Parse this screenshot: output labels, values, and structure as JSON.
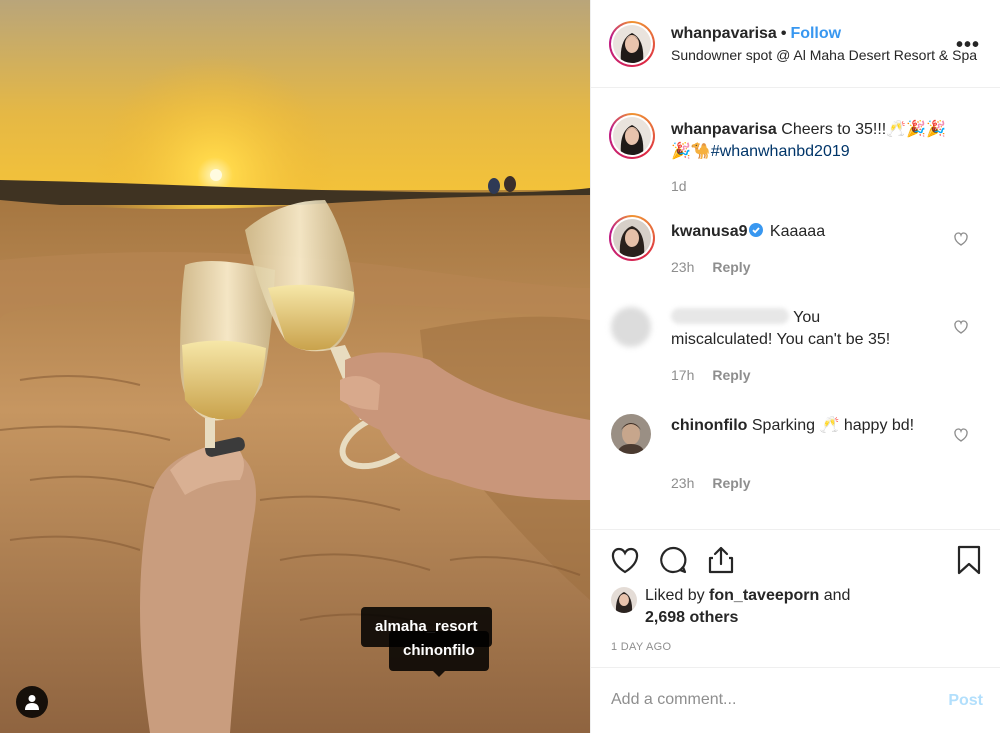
{
  "photo": {
    "tags": [
      "almaha_resort",
      "chinonfilo"
    ]
  },
  "post_header": {
    "username": "whanpavarisa",
    "dot": "•",
    "follow_label": "Follow",
    "location": "Sundowner spot @ Al Maha Desert Resort & Spa",
    "more_label": "•••"
  },
  "comments": [
    {
      "username": "whanpavarisa",
      "text": " Cheers to 35!!!🥂🎉🎉",
      "text2": "🎉🐪",
      "hashtag": "#whanwhanbd2019",
      "time": "1d",
      "reply": ""
    },
    {
      "username": "kwanusa9",
      "text": " Kaaaaa",
      "time": "23h",
      "reply": "Reply"
    },
    {
      "username": "",
      "text_line1": " You",
      "text_line2": "miscalculated! You can't be 35!",
      "time": "17h",
      "reply": "Reply"
    },
    {
      "username": "chinonfilo",
      "text": " Sparking 🥂 happy bd!",
      "time": "23h",
      "reply": "Reply"
    }
  ],
  "actions": {
    "liked_by_prefix": "Liked by ",
    "liked_by_user": "fon_taveeporn",
    "liked_by_mid": " and",
    "liked_count": "2,698 others",
    "time_ago": "1 day ago"
  },
  "add_comment": {
    "placeholder": "Add a comment...",
    "post_label": "Post"
  },
  "colors": {
    "link_blue": "#3897f0",
    "hashtag_blue": "#003569",
    "post_disabled": "#b2dffc",
    "muted": "#8e8e8e"
  }
}
